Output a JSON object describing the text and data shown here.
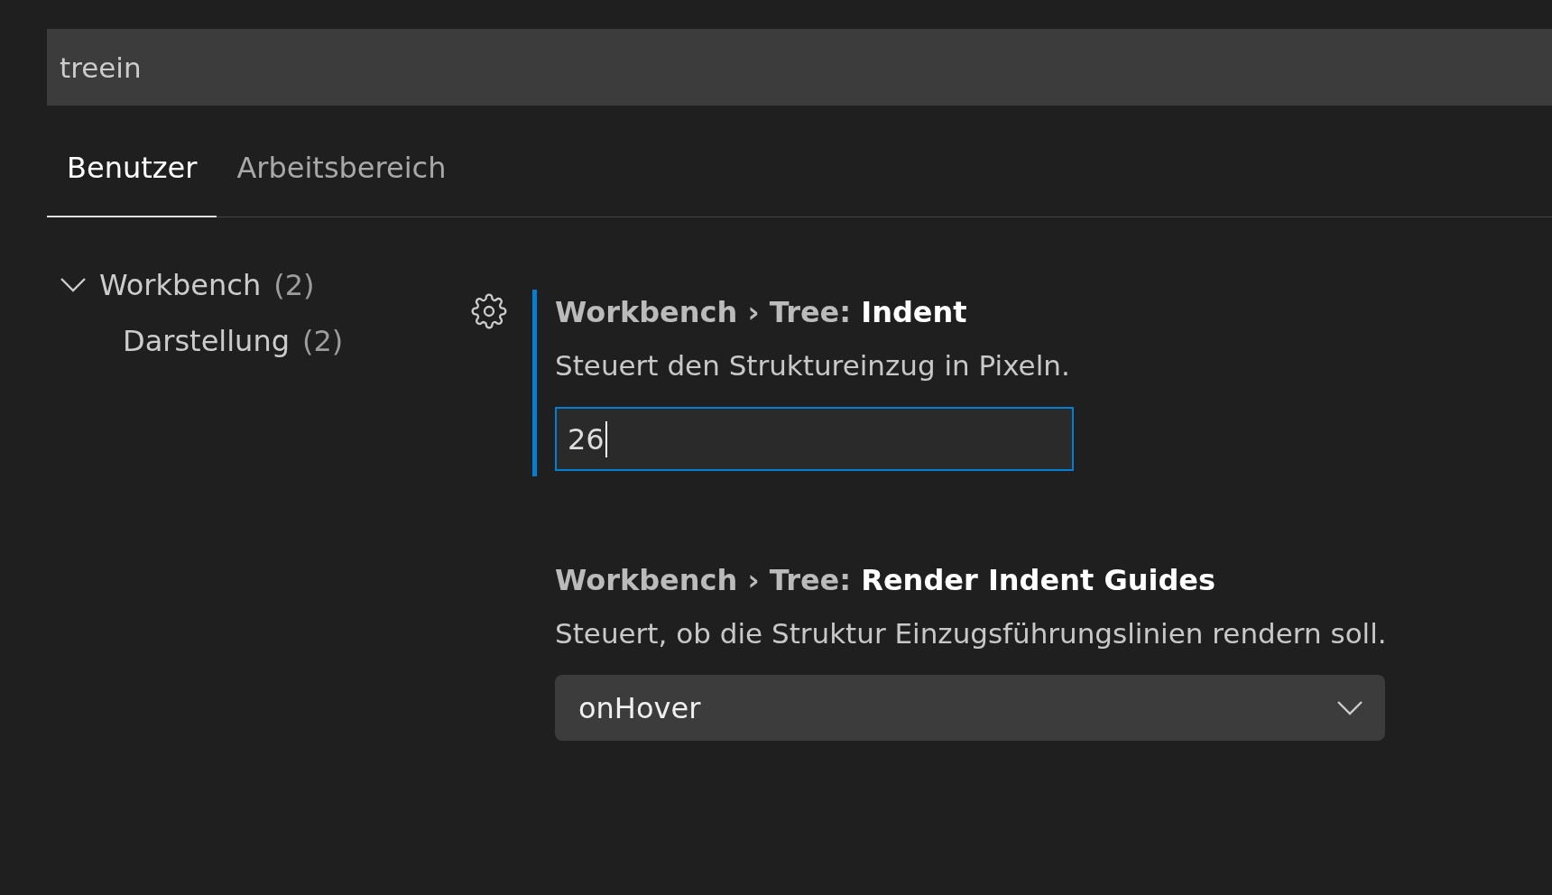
{
  "search": {
    "value": "treein"
  },
  "tabs": [
    {
      "label": "Benutzer",
      "selected": true
    },
    {
      "label": "Arbeitsbereich",
      "selected": false
    }
  ],
  "tree": [
    {
      "label": "Workbench",
      "count": "(2)",
      "expanded": true,
      "children": [
        {
          "label": "Darstellung",
          "count": "(2)"
        }
      ]
    }
  ],
  "settings": [
    {
      "kind": "number",
      "category": "Workbench › Tree:",
      "label": "Indent",
      "description": "Steuert den Struktureinzug in Pixeln.",
      "value": "26",
      "focused": true
    },
    {
      "kind": "select",
      "category": "Workbench › Tree:",
      "label": "Render Indent Guides",
      "description": "Steuert, ob die Struktur Einzugsführungslinien rendern soll.",
      "value": "onHover",
      "focused": false
    }
  ]
}
